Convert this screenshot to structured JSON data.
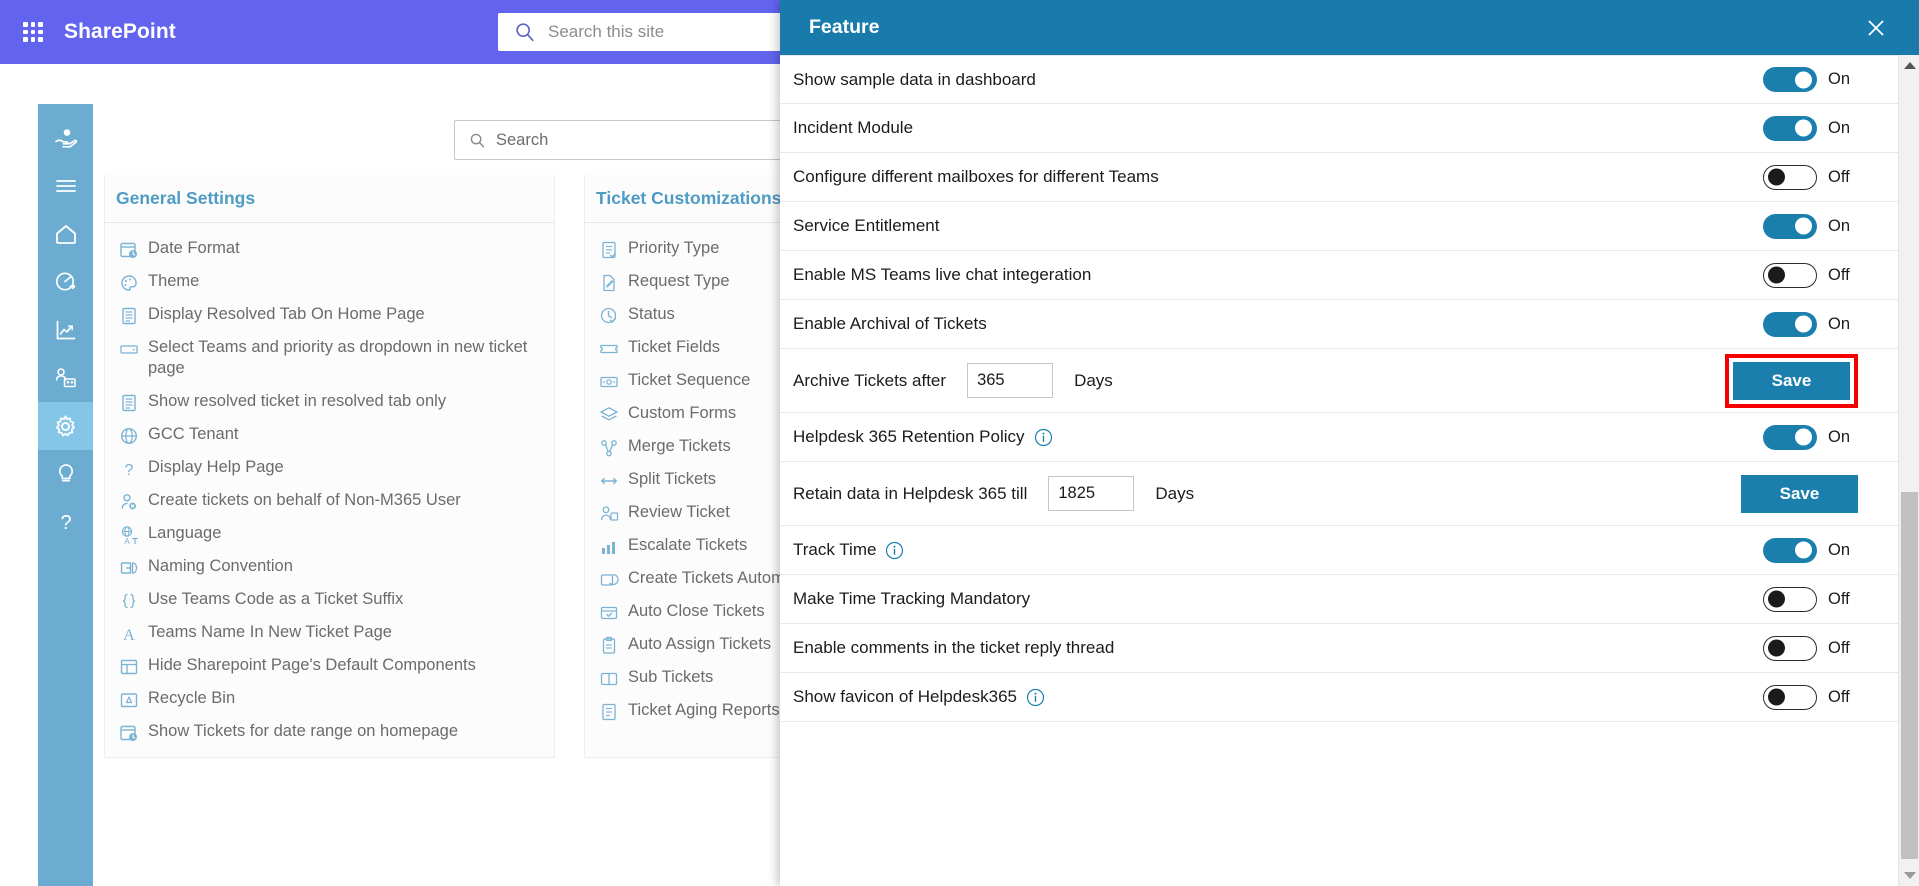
{
  "suitebar": {
    "waffle_label": "app-launcher",
    "title": "SharePoint",
    "search_placeholder": "Search this site"
  },
  "rail": {
    "items": [
      {
        "icon": "support-hand-icon",
        "active": false
      },
      {
        "icon": "hamburger-menu-icon",
        "active": false
      },
      {
        "icon": "home-icon",
        "active": false
      },
      {
        "icon": "dashboard-gauge-icon",
        "active": false
      },
      {
        "icon": "analytics-chart-icon",
        "active": false
      },
      {
        "icon": "team-users-icon",
        "active": false
      },
      {
        "icon": "gear-settings-icon",
        "active": true
      },
      {
        "icon": "lightbulb-icon",
        "active": false
      },
      {
        "icon": "question-help-icon",
        "active": false
      }
    ]
  },
  "page": {
    "search_placeholder": "Search"
  },
  "cards": [
    {
      "title": "General Settings",
      "items": [
        {
          "label": "Date Format",
          "icon": "calendar-clock-icon"
        },
        {
          "label": "Theme",
          "icon": "palette-icon"
        },
        {
          "label": "Display Resolved Tab On Home Page",
          "icon": "document-icon"
        },
        {
          "label": "Select Teams and priority as dropdown in new ticket page",
          "icon": "dropdown-icon"
        },
        {
          "label": "Show resolved ticket in resolved tab only",
          "icon": "document-icon"
        },
        {
          "label": "GCC Tenant",
          "icon": "globe-icon"
        },
        {
          "label": "Display Help Page",
          "icon": "question-icon"
        },
        {
          "label": "Create tickets on behalf of Non-M365 User",
          "icon": "user-block-icon"
        },
        {
          "label": "Language",
          "icon": "translate-icon"
        },
        {
          "label": "Naming Convention",
          "icon": "rename-icon"
        },
        {
          "label": "Use Teams Code as a Ticket Suffix",
          "icon": "braces-icon"
        },
        {
          "label": "Teams Name In New Ticket Page",
          "icon": "letter-a-icon"
        },
        {
          "label": "Hide Sharepoint Page's Default Components",
          "icon": "layout-icon"
        },
        {
          "label": "Recycle Bin",
          "icon": "recycle-bin-icon"
        },
        {
          "label": "Show Tickets for date range on homepage",
          "icon": "calendar-range-icon"
        }
      ]
    },
    {
      "title": "Ticket Customizations",
      "items": [
        {
          "label": "Priority Type",
          "icon": "checklist-icon"
        },
        {
          "label": "Request Type",
          "icon": "edit-document-icon"
        },
        {
          "label": "Status",
          "icon": "clock-check-icon"
        },
        {
          "label": "Ticket Fields",
          "icon": "ticket-icon"
        },
        {
          "label": "Ticket Sequence",
          "icon": "money-sequence-icon"
        },
        {
          "label": "Custom Forms",
          "icon": "layers-icon"
        },
        {
          "label": "Merge Tickets",
          "icon": "merge-icon"
        },
        {
          "label": "Split Tickets",
          "icon": "split-arrows-icon"
        },
        {
          "label": "Review Ticket",
          "icon": "review-person-icon"
        },
        {
          "label": "Escalate Tickets",
          "icon": "escalate-chart-icon"
        },
        {
          "label": "Create Tickets Automatically",
          "icon": "auto-create-icon"
        },
        {
          "label": "Auto Close Tickets",
          "icon": "auto-close-icon"
        },
        {
          "label": "Auto Assign Tickets",
          "icon": "clipboard-assign-icon"
        },
        {
          "label": "Sub Tickets",
          "icon": "columns-icon"
        },
        {
          "label": "Ticket Aging Reports",
          "icon": "report-icon"
        }
      ]
    }
  ],
  "panel": {
    "title": "Feature",
    "close_label": "close",
    "rows": [
      {
        "kind": "toggle",
        "label": "Show sample data in dashboard",
        "state": "On",
        "on": true,
        "info": false
      },
      {
        "kind": "toggle",
        "label": "Incident Module",
        "state": "On",
        "on": true,
        "info": false
      },
      {
        "kind": "toggle",
        "label": "Configure different mailboxes for different Teams",
        "state": "Off",
        "on": false,
        "info": false
      },
      {
        "kind": "toggle",
        "label": "Service Entitlement",
        "state": "On",
        "on": true,
        "info": false
      },
      {
        "kind": "toggle",
        "label": "Enable MS Teams live chat integeration",
        "state": "Off",
        "on": false,
        "info": false
      },
      {
        "kind": "toggle",
        "label": "Enable Archival of Tickets",
        "state": "On",
        "on": true,
        "info": false
      },
      {
        "kind": "input",
        "label": "Archive Tickets after",
        "value": "365",
        "unit": "Days",
        "button": "Save",
        "highlight": true
      },
      {
        "kind": "toggle",
        "label": "Helpdesk 365 Retention Policy",
        "state": "On",
        "on": true,
        "info": true
      },
      {
        "kind": "input",
        "label": "Retain data in Helpdesk 365 till",
        "value": "1825",
        "unit": "Days",
        "button": "Save",
        "highlight": false
      },
      {
        "kind": "toggle",
        "label": "Track Time",
        "state": "On",
        "on": true,
        "info": true
      },
      {
        "kind": "toggle",
        "label": "Make Time Tracking Mandatory",
        "state": "Off",
        "on": false,
        "info": false
      },
      {
        "kind": "toggle",
        "label": "Enable comments in the ticket reply thread",
        "state": "Off",
        "on": false,
        "info": false
      },
      {
        "kind": "toggle",
        "label": "Show favicon of Helpdesk365",
        "state": "Off",
        "on": false,
        "info": true
      }
    ]
  },
  "colors": {
    "suitebar": "#6264f0",
    "panel_header": "#187bac",
    "toggle_on": "#1b7fae",
    "save_button": "#1b7fae",
    "highlight_border": "#f40000",
    "rail": "#6bacd0",
    "rail_active": "#85c6e8",
    "card_title": "#4e9bc4"
  }
}
